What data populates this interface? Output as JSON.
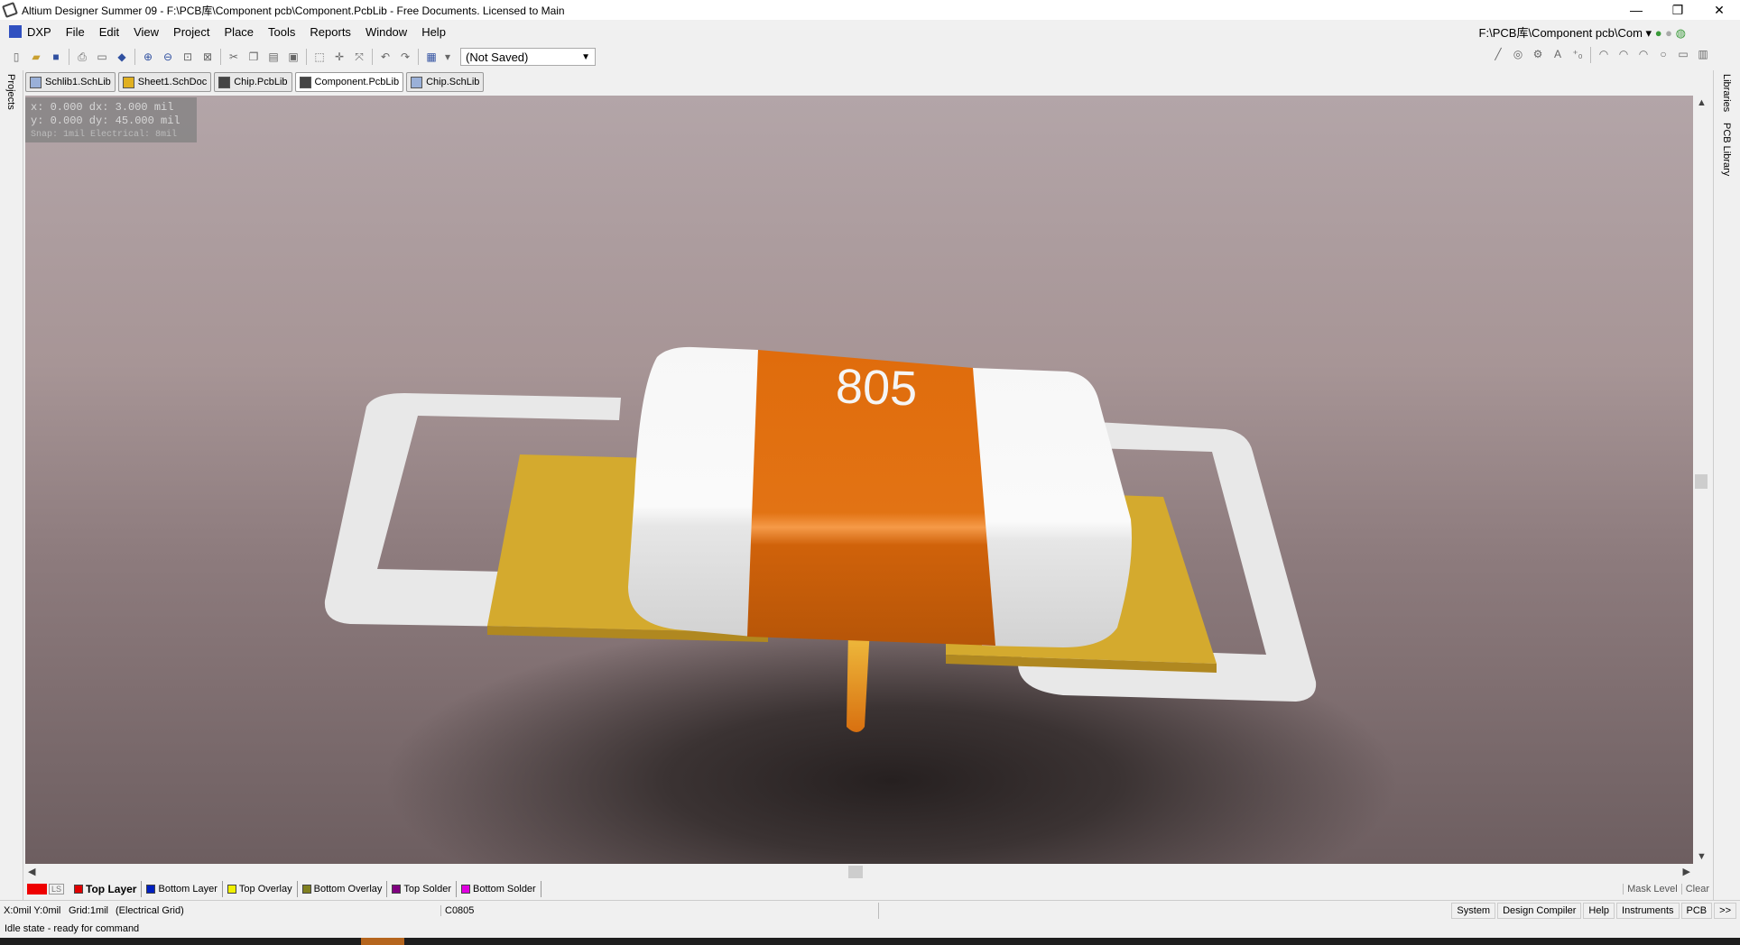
{
  "window": {
    "title": "Altium Designer Summer 09 - F:\\PCB库\\Component pcb\\Component.PcbLib - Free Documents. Licensed to Main",
    "minimize": "—",
    "restore": "❐",
    "close": "✕"
  },
  "menu": {
    "dxp": "DXP",
    "items": [
      "File",
      "Edit",
      "View",
      "Project",
      "Place",
      "Tools",
      "Reports",
      "Window",
      "Help"
    ],
    "path": "F:\\PCB库\\Component pcb\\Com"
  },
  "toolbar": {
    "select_value": "(Not Saved)"
  },
  "doc_tabs": [
    "Schlib1.SchLib",
    "Sheet1.SchDoc",
    "Chip.PcbLib",
    "Component.PcbLib",
    "Chip.SchLib"
  ],
  "side_panels": {
    "left": "Projects",
    "right_top": "Libraries",
    "right_bottom": "PCB Library"
  },
  "coords": {
    "line1": "x:   0.000  dx:   3.000 mil",
    "line2": "y:   0.000  dy:  45.000 mil",
    "snap": "Snap: 1mil Electrical: 8mil"
  },
  "component": {
    "marking": "805",
    "body_color": "#dd6a0a",
    "pad_color": "#d4aa2e",
    "cap_color": "#f2f2f2"
  },
  "layers": {
    "ls_label": "LS",
    "tabs": [
      {
        "label": "Top Layer",
        "color": "#e00000",
        "active": true
      },
      {
        "label": "Bottom Layer",
        "color": "#0020c0",
        "active": false
      },
      {
        "label": "Top Overlay",
        "color": "#f0f000",
        "active": false
      },
      {
        "label": "Bottom Overlay",
        "color": "#808020",
        "active": false
      },
      {
        "label": "Top Solder",
        "color": "#800080",
        "active": false
      },
      {
        "label": "Bottom Solder",
        "color": "#e000e0",
        "active": false
      }
    ],
    "mask_level": "Mask Level",
    "clear": "Clear"
  },
  "status": {
    "coords": "X:0mil Y:0mil",
    "grid": "Grid:1mil",
    "grid_type": "(Electrical Grid)",
    "component_name": "C0805",
    "idle": "Idle state - ready for command",
    "buttons": [
      "System",
      "Design Compiler",
      "Help",
      "Instruments",
      "PCB",
      ">>"
    ]
  }
}
